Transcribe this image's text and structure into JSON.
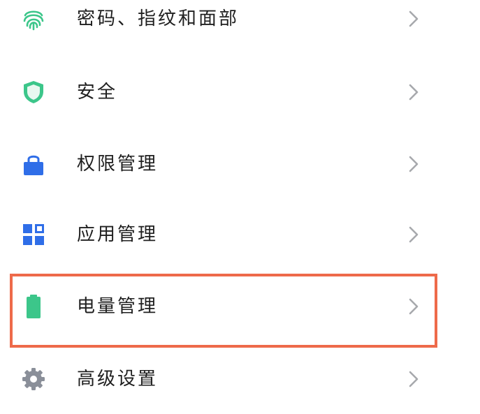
{
  "settings": {
    "items": [
      {
        "label": "密码、指纹和面部",
        "icon": "fingerprint-icon",
        "icon_color": "#3cc68a"
      },
      {
        "label": "安全",
        "icon": "shield-icon",
        "icon_color": "#3cc68a"
      },
      {
        "label": "权限管理",
        "icon": "lock-icon",
        "icon_color": "#2f6ee8"
      },
      {
        "label": "应用管理",
        "icon": "apps-grid-icon",
        "icon_color": "#2f6ee8"
      },
      {
        "label": "电量管理",
        "icon": "battery-icon",
        "icon_color": "#3cc68a"
      },
      {
        "label": "高级设置",
        "icon": "gear-icon",
        "icon_color": "#8a8f99"
      }
    ],
    "chevron_icon": "chevron-right-icon"
  },
  "highlight": {
    "target": "电量管理",
    "color": "#ee6a4a"
  }
}
